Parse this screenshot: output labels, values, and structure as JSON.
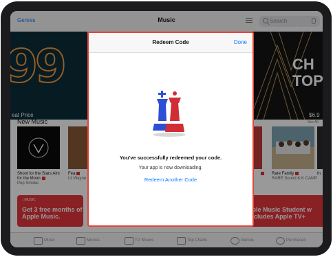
{
  "nav": {
    "genres": "Genres",
    "title": "Music",
    "search_placeholder": "Search"
  },
  "hero": {
    "left_caption": "eat Price",
    "right_line1": "CH",
    "right_line2": "TOP",
    "right_caption": "$6.9"
  },
  "new_music": {
    "title": "New Music",
    "see_all": "See All",
    "albums": [
      {
        "title": "Shoot for the Stars Aim for the Moon",
        "artist": "Pop Smoke"
      },
      {
        "title": "Fea",
        "artist": "Lil Wayne"
      },
      {
        "title": "Rare Family",
        "artist": "RARE Sound & K CAMP"
      },
      {
        "title": "In",
        "artist": ""
      }
    ]
  },
  "promos": {
    "left_brand": "MUSIC",
    "left_text": "Get 3 free months of Apple Music.",
    "right_text": "pple Music Student w includes Apple TV+"
  },
  "tabs": [
    {
      "label": "Music",
      "icon": "music-note-icon"
    },
    {
      "label": "Movies",
      "icon": "film-icon"
    },
    {
      "label": "TV Shows",
      "icon": "tv-icon"
    },
    {
      "label": "Top Charts",
      "icon": "top-charts-icon"
    },
    {
      "label": "Genius",
      "icon": "genius-icon"
    },
    {
      "label": "Purchased",
      "icon": "purchased-icon"
    }
  ],
  "modal": {
    "title": "Redeem Code",
    "done": "Done",
    "success": "You've successfully redeemed your code.",
    "status": "Your app is now downloading.",
    "link": "Redeem Another Code"
  },
  "colors": {
    "accent": "#0a7aff",
    "brand_red": "#e4363d",
    "modal_border": "#e4453a"
  }
}
